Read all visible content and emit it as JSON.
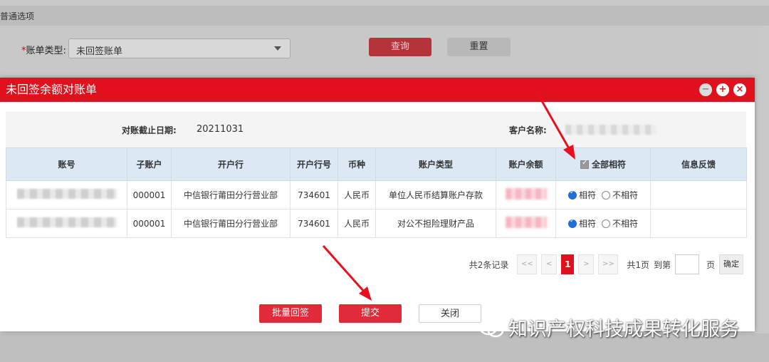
{
  "background": {
    "section_title": "普通选项",
    "bill_type_label": "账单类型:",
    "required_mark": "*",
    "bill_type_value": "未回签账单",
    "query_button": "查询",
    "reset_button": "重置"
  },
  "modal": {
    "title": "未回签余额对账单",
    "controls": {
      "min": "−",
      "max": "+",
      "close": "×"
    },
    "cutoff_label": "对账截止日期:",
    "cutoff_value": "20211031",
    "customer_label": "客户名称:",
    "table": {
      "headers": [
        "账号",
        "子账户",
        "开户行",
        "开户行号",
        "币种",
        "账户类型",
        "账户余额",
        "全部相符",
        "信息反馈"
      ],
      "rows": [
        {
          "sub_account": "000001",
          "bank": "中信银行莆田分行营业部",
          "bank_code": "734601",
          "currency": "人民币",
          "account_type": "单位人民币结算账户存款",
          "match": "相符",
          "mismatch": "不相符"
        },
        {
          "sub_account": "000001",
          "bank": "中信银行莆田分行营业部",
          "bank_code": "734601",
          "currency": "人民币",
          "account_type": "对公不担险理财产品",
          "match": "相符",
          "mismatch": "不相符"
        }
      ]
    },
    "pager": {
      "total": "共2条记录",
      "first": "<<",
      "prev": "<",
      "current": "1",
      "next": ">",
      "last": ">>",
      "pages": "共1页",
      "goto": "到第",
      "page_unit": "页",
      "ok": "确定"
    },
    "buttons": {
      "batch_sign": "批量回签",
      "submit": "提交",
      "close": "关闭"
    }
  },
  "watermark": "知识产权科技成果转化服务",
  "colors": {
    "accent": "#e0101c",
    "header_bg": "#dce9f5",
    "radio": "#1e6fd9"
  }
}
